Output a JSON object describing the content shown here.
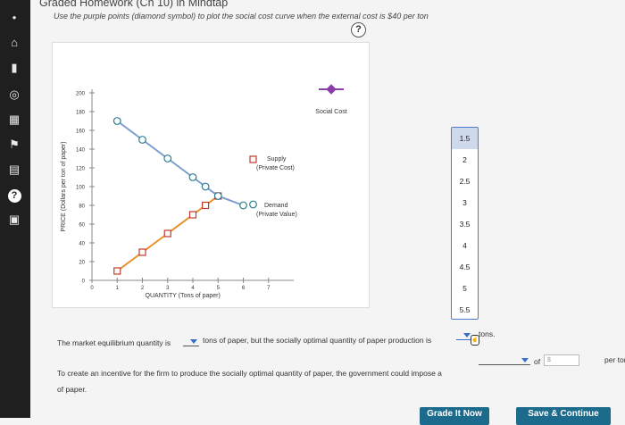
{
  "header": {
    "title": "Graded Homework (Ch 10) in Mindtap",
    "instruction": "Use the purple points (diamond symbol) to plot the social cost curve when the external cost is $40 per ton",
    "help_label": "?"
  },
  "rail": {
    "items": [
      {
        "name": "dot-icon",
        "glyph": "•"
      },
      {
        "name": "home-icon",
        "glyph": "⌂"
      },
      {
        "name": "book-icon",
        "glyph": "▮"
      },
      {
        "name": "compass-icon",
        "glyph": "◎"
      },
      {
        "name": "grid-icon",
        "glyph": "▦"
      },
      {
        "name": "graduation-icon",
        "glyph": "🎓"
      },
      {
        "name": "gift-icon",
        "glyph": "🗃"
      },
      {
        "name": "help-icon",
        "glyph": "?"
      },
      {
        "name": "card-icon",
        "glyph": "▣"
      }
    ]
  },
  "chart_data": {
    "type": "line",
    "xlabel": "QUANTITY (Tons of paper)",
    "ylabel": "PRICE (Dollars per ton of paper)",
    "xlim": [
      0,
      8
    ],
    "ylim": [
      0,
      200
    ],
    "x_ticks": [
      "0",
      "1",
      "2",
      "3",
      "4",
      "5",
      "6",
      "7"
    ],
    "y_ticks": [
      "0",
      "20",
      "40",
      "60",
      "80",
      "100",
      "120",
      "140",
      "160",
      "180",
      "200"
    ],
    "series": [
      {
        "name": "Supply (Private Cost)",
        "color": "#e8902a",
        "marker": "square",
        "x": [
          1,
          2,
          3,
          4,
          4.5,
          5
        ],
        "y": [
          10,
          30,
          50,
          70,
          80,
          90
        ]
      },
      {
        "name": "Demand (Private Value)",
        "color": "#7a9ed0",
        "marker": "circle",
        "x": [
          1,
          2,
          3,
          4,
          4.5,
          5,
          6
        ],
        "y": [
          170,
          150,
          130,
          110,
          100,
          90,
          80
        ]
      }
    ],
    "legend": {
      "social_cost": "Social Cost",
      "supply_line1": "Supply",
      "supply_line2": "(Private Cost)",
      "demand_line1": "Demand",
      "demand_line2": "(Private Value)"
    },
    "social_cost_color": "#8a3fa8"
  },
  "dropdown": {
    "options": [
      "1.5",
      "2",
      "2.5",
      "3",
      "3.5",
      "4",
      "4.5",
      "5",
      "5.5"
    ],
    "selected_index": 0
  },
  "question": {
    "line1_a": "The market equilibrium quantity is",
    "line1_b": "tons of paper, but the socially optimal quantity of paper production is",
    "line1_c": "tons.",
    "line2_a": "To create an incentive for the firm to produce the socially optimal quantity of paper, the government could impose a",
    "line2_of": "of",
    "line2_input_placeholder": "$",
    "line2_b": "per ton",
    "line3": "of paper."
  },
  "buttons": {
    "grade": "Grade It Now",
    "save": "Save & Continue"
  }
}
